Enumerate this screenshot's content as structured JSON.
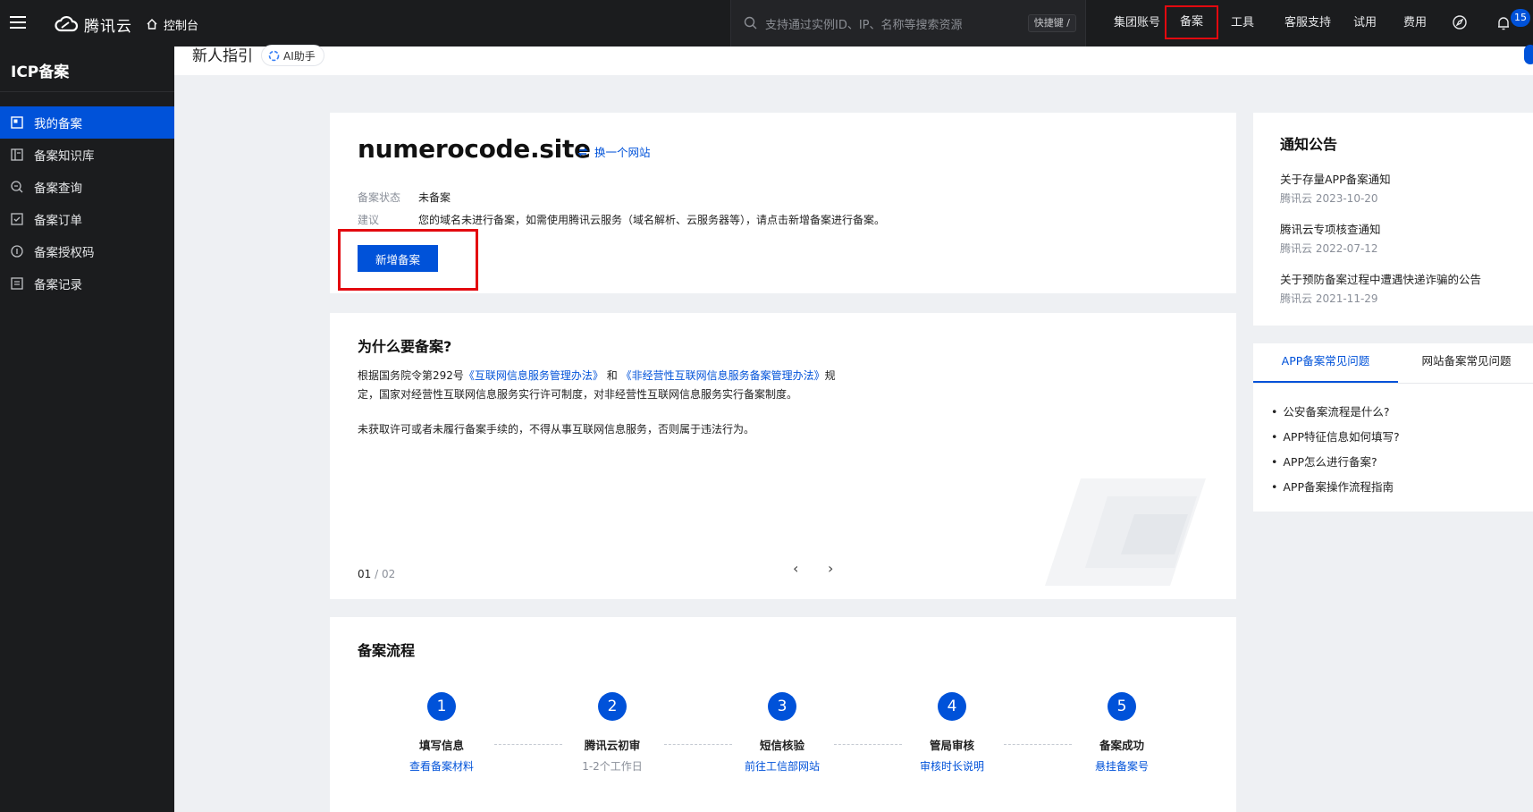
{
  "topbar": {
    "logo_text": "腾讯云",
    "console_label": "控制台",
    "search_placeholder": "支持通过实例ID、IP、名称等搜索资源",
    "shortcut_label": "快捷键 /",
    "nav_items": [
      "集团账号",
      "备案",
      "工具",
      "客服支持",
      "试用",
      "费用"
    ],
    "active_nav": "备案",
    "notification_count": "15",
    "accent_color": "#0052d9",
    "highlight_color": "#e3090f"
  },
  "sidebar": {
    "title": "ICP备案",
    "items": [
      {
        "label": "我的备案",
        "icon": "my-filing-icon",
        "active": true
      },
      {
        "label": "备案知识库",
        "icon": "knowledge-base-icon",
        "active": false
      },
      {
        "label": "备案查询",
        "icon": "query-icon",
        "active": false
      },
      {
        "label": "备案订单",
        "icon": "order-icon",
        "active": false
      },
      {
        "label": "备案授权码",
        "icon": "auth-code-icon",
        "active": false
      },
      {
        "label": "备案记录",
        "icon": "record-icon",
        "active": false
      }
    ]
  },
  "subheader": {
    "title": "新人指引",
    "ai_label": "AI助手"
  },
  "domain_card": {
    "domain": "numerocode.site",
    "switch_label": "换一个网站",
    "status_label": "备案状态",
    "status_value": "未备案",
    "advice_label": "建议",
    "advice_value": "您的域名未进行备案，如需使用腾讯云服务（域名解析、云服务器等），请点击新增备案进行备案。",
    "add_button": "新增备案"
  },
  "why_card": {
    "title": "为什么要备案?",
    "p1_prefix": "根据国务院令第292号",
    "p1_link1": "《互联网信息服务管理办法》",
    "p1_and": "和",
    "p1_link2": "《非经营性互联网信息服务备案管理办法》",
    "p1_suffix": "规定，国家对经营性互联网信息服务实行许可制度，对非经营性互联网信息服务实行备案制度。",
    "p2": "未获取许可或者未履行备案手续的，不得从事互联网信息服务，否则属于违法行为。",
    "page_current": "01",
    "page_sep": " / ",
    "page_total": "02",
    "prev_symbol": "‹",
    "next_symbol": "›"
  },
  "flow_card": {
    "title": "备案流程",
    "steps": [
      {
        "num": "1",
        "title": "填写信息",
        "sub": "查看备案材料",
        "sub_is_link": true
      },
      {
        "num": "2",
        "title": "腾讯云初审",
        "sub": "1-2个工作日",
        "sub_is_link": false
      },
      {
        "num": "3",
        "title": "短信核验",
        "sub": "前往工信部网站",
        "sub_is_link": true
      },
      {
        "num": "4",
        "title": "管局审核",
        "sub": "审核时长说明",
        "sub_is_link": true
      },
      {
        "num": "5",
        "title": "备案成功",
        "sub": "悬挂备案号",
        "sub_is_link": true
      }
    ]
  },
  "notice_card": {
    "title": "通知公告",
    "items": [
      {
        "title": "关于存量APP备案通知",
        "meta": "腾讯云 2023-10-20"
      },
      {
        "title": "腾讯云专项核查通知",
        "meta": "腾讯云 2022-07-12"
      },
      {
        "title": "关于预防备案过程中遭遇快递诈骗的公告",
        "meta": "腾讯云 2021-11-29"
      }
    ]
  },
  "faq_card": {
    "tabs": [
      "APP备案常见问题",
      "网站备案常见问题"
    ],
    "active_tab": 0,
    "items": [
      "公安备案流程是什么?",
      "APP特征信息如何填写?",
      "APP怎么进行备案?",
      "APP备案操作流程指南"
    ]
  }
}
